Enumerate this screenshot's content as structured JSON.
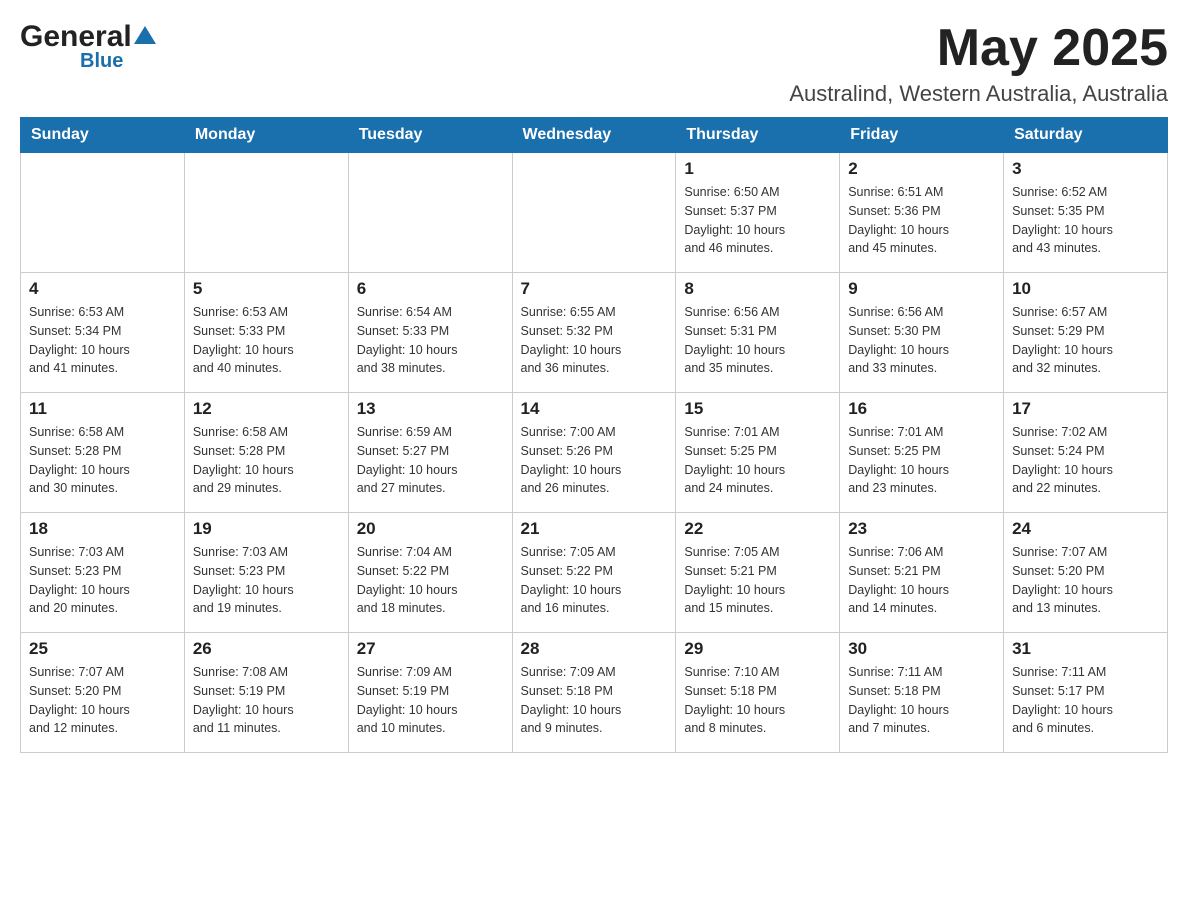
{
  "header": {
    "logo_general": "General",
    "logo_blue": "Blue",
    "month_title": "May 2025",
    "location": "Australind, Western Australia, Australia"
  },
  "weekdays": [
    "Sunday",
    "Monday",
    "Tuesday",
    "Wednesday",
    "Thursday",
    "Friday",
    "Saturday"
  ],
  "weeks": [
    [
      {
        "day": "",
        "info": ""
      },
      {
        "day": "",
        "info": ""
      },
      {
        "day": "",
        "info": ""
      },
      {
        "day": "",
        "info": ""
      },
      {
        "day": "1",
        "info": "Sunrise: 6:50 AM\nSunset: 5:37 PM\nDaylight: 10 hours\nand 46 minutes."
      },
      {
        "day": "2",
        "info": "Sunrise: 6:51 AM\nSunset: 5:36 PM\nDaylight: 10 hours\nand 45 minutes."
      },
      {
        "day": "3",
        "info": "Sunrise: 6:52 AM\nSunset: 5:35 PM\nDaylight: 10 hours\nand 43 minutes."
      }
    ],
    [
      {
        "day": "4",
        "info": "Sunrise: 6:53 AM\nSunset: 5:34 PM\nDaylight: 10 hours\nand 41 minutes."
      },
      {
        "day": "5",
        "info": "Sunrise: 6:53 AM\nSunset: 5:33 PM\nDaylight: 10 hours\nand 40 minutes."
      },
      {
        "day": "6",
        "info": "Sunrise: 6:54 AM\nSunset: 5:33 PM\nDaylight: 10 hours\nand 38 minutes."
      },
      {
        "day": "7",
        "info": "Sunrise: 6:55 AM\nSunset: 5:32 PM\nDaylight: 10 hours\nand 36 minutes."
      },
      {
        "day": "8",
        "info": "Sunrise: 6:56 AM\nSunset: 5:31 PM\nDaylight: 10 hours\nand 35 minutes."
      },
      {
        "day": "9",
        "info": "Sunrise: 6:56 AM\nSunset: 5:30 PM\nDaylight: 10 hours\nand 33 minutes."
      },
      {
        "day": "10",
        "info": "Sunrise: 6:57 AM\nSunset: 5:29 PM\nDaylight: 10 hours\nand 32 minutes."
      }
    ],
    [
      {
        "day": "11",
        "info": "Sunrise: 6:58 AM\nSunset: 5:28 PM\nDaylight: 10 hours\nand 30 minutes."
      },
      {
        "day": "12",
        "info": "Sunrise: 6:58 AM\nSunset: 5:28 PM\nDaylight: 10 hours\nand 29 minutes."
      },
      {
        "day": "13",
        "info": "Sunrise: 6:59 AM\nSunset: 5:27 PM\nDaylight: 10 hours\nand 27 minutes."
      },
      {
        "day": "14",
        "info": "Sunrise: 7:00 AM\nSunset: 5:26 PM\nDaylight: 10 hours\nand 26 minutes."
      },
      {
        "day": "15",
        "info": "Sunrise: 7:01 AM\nSunset: 5:25 PM\nDaylight: 10 hours\nand 24 minutes."
      },
      {
        "day": "16",
        "info": "Sunrise: 7:01 AM\nSunset: 5:25 PM\nDaylight: 10 hours\nand 23 minutes."
      },
      {
        "day": "17",
        "info": "Sunrise: 7:02 AM\nSunset: 5:24 PM\nDaylight: 10 hours\nand 22 minutes."
      }
    ],
    [
      {
        "day": "18",
        "info": "Sunrise: 7:03 AM\nSunset: 5:23 PM\nDaylight: 10 hours\nand 20 minutes."
      },
      {
        "day": "19",
        "info": "Sunrise: 7:03 AM\nSunset: 5:23 PM\nDaylight: 10 hours\nand 19 minutes."
      },
      {
        "day": "20",
        "info": "Sunrise: 7:04 AM\nSunset: 5:22 PM\nDaylight: 10 hours\nand 18 minutes."
      },
      {
        "day": "21",
        "info": "Sunrise: 7:05 AM\nSunset: 5:22 PM\nDaylight: 10 hours\nand 16 minutes."
      },
      {
        "day": "22",
        "info": "Sunrise: 7:05 AM\nSunset: 5:21 PM\nDaylight: 10 hours\nand 15 minutes."
      },
      {
        "day": "23",
        "info": "Sunrise: 7:06 AM\nSunset: 5:21 PM\nDaylight: 10 hours\nand 14 minutes."
      },
      {
        "day": "24",
        "info": "Sunrise: 7:07 AM\nSunset: 5:20 PM\nDaylight: 10 hours\nand 13 minutes."
      }
    ],
    [
      {
        "day": "25",
        "info": "Sunrise: 7:07 AM\nSunset: 5:20 PM\nDaylight: 10 hours\nand 12 minutes."
      },
      {
        "day": "26",
        "info": "Sunrise: 7:08 AM\nSunset: 5:19 PM\nDaylight: 10 hours\nand 11 minutes."
      },
      {
        "day": "27",
        "info": "Sunrise: 7:09 AM\nSunset: 5:19 PM\nDaylight: 10 hours\nand 10 minutes."
      },
      {
        "day": "28",
        "info": "Sunrise: 7:09 AM\nSunset: 5:18 PM\nDaylight: 10 hours\nand 9 minutes."
      },
      {
        "day": "29",
        "info": "Sunrise: 7:10 AM\nSunset: 5:18 PM\nDaylight: 10 hours\nand 8 minutes."
      },
      {
        "day": "30",
        "info": "Sunrise: 7:11 AM\nSunset: 5:18 PM\nDaylight: 10 hours\nand 7 minutes."
      },
      {
        "day": "31",
        "info": "Sunrise: 7:11 AM\nSunset: 5:17 PM\nDaylight: 10 hours\nand 6 minutes."
      }
    ]
  ]
}
